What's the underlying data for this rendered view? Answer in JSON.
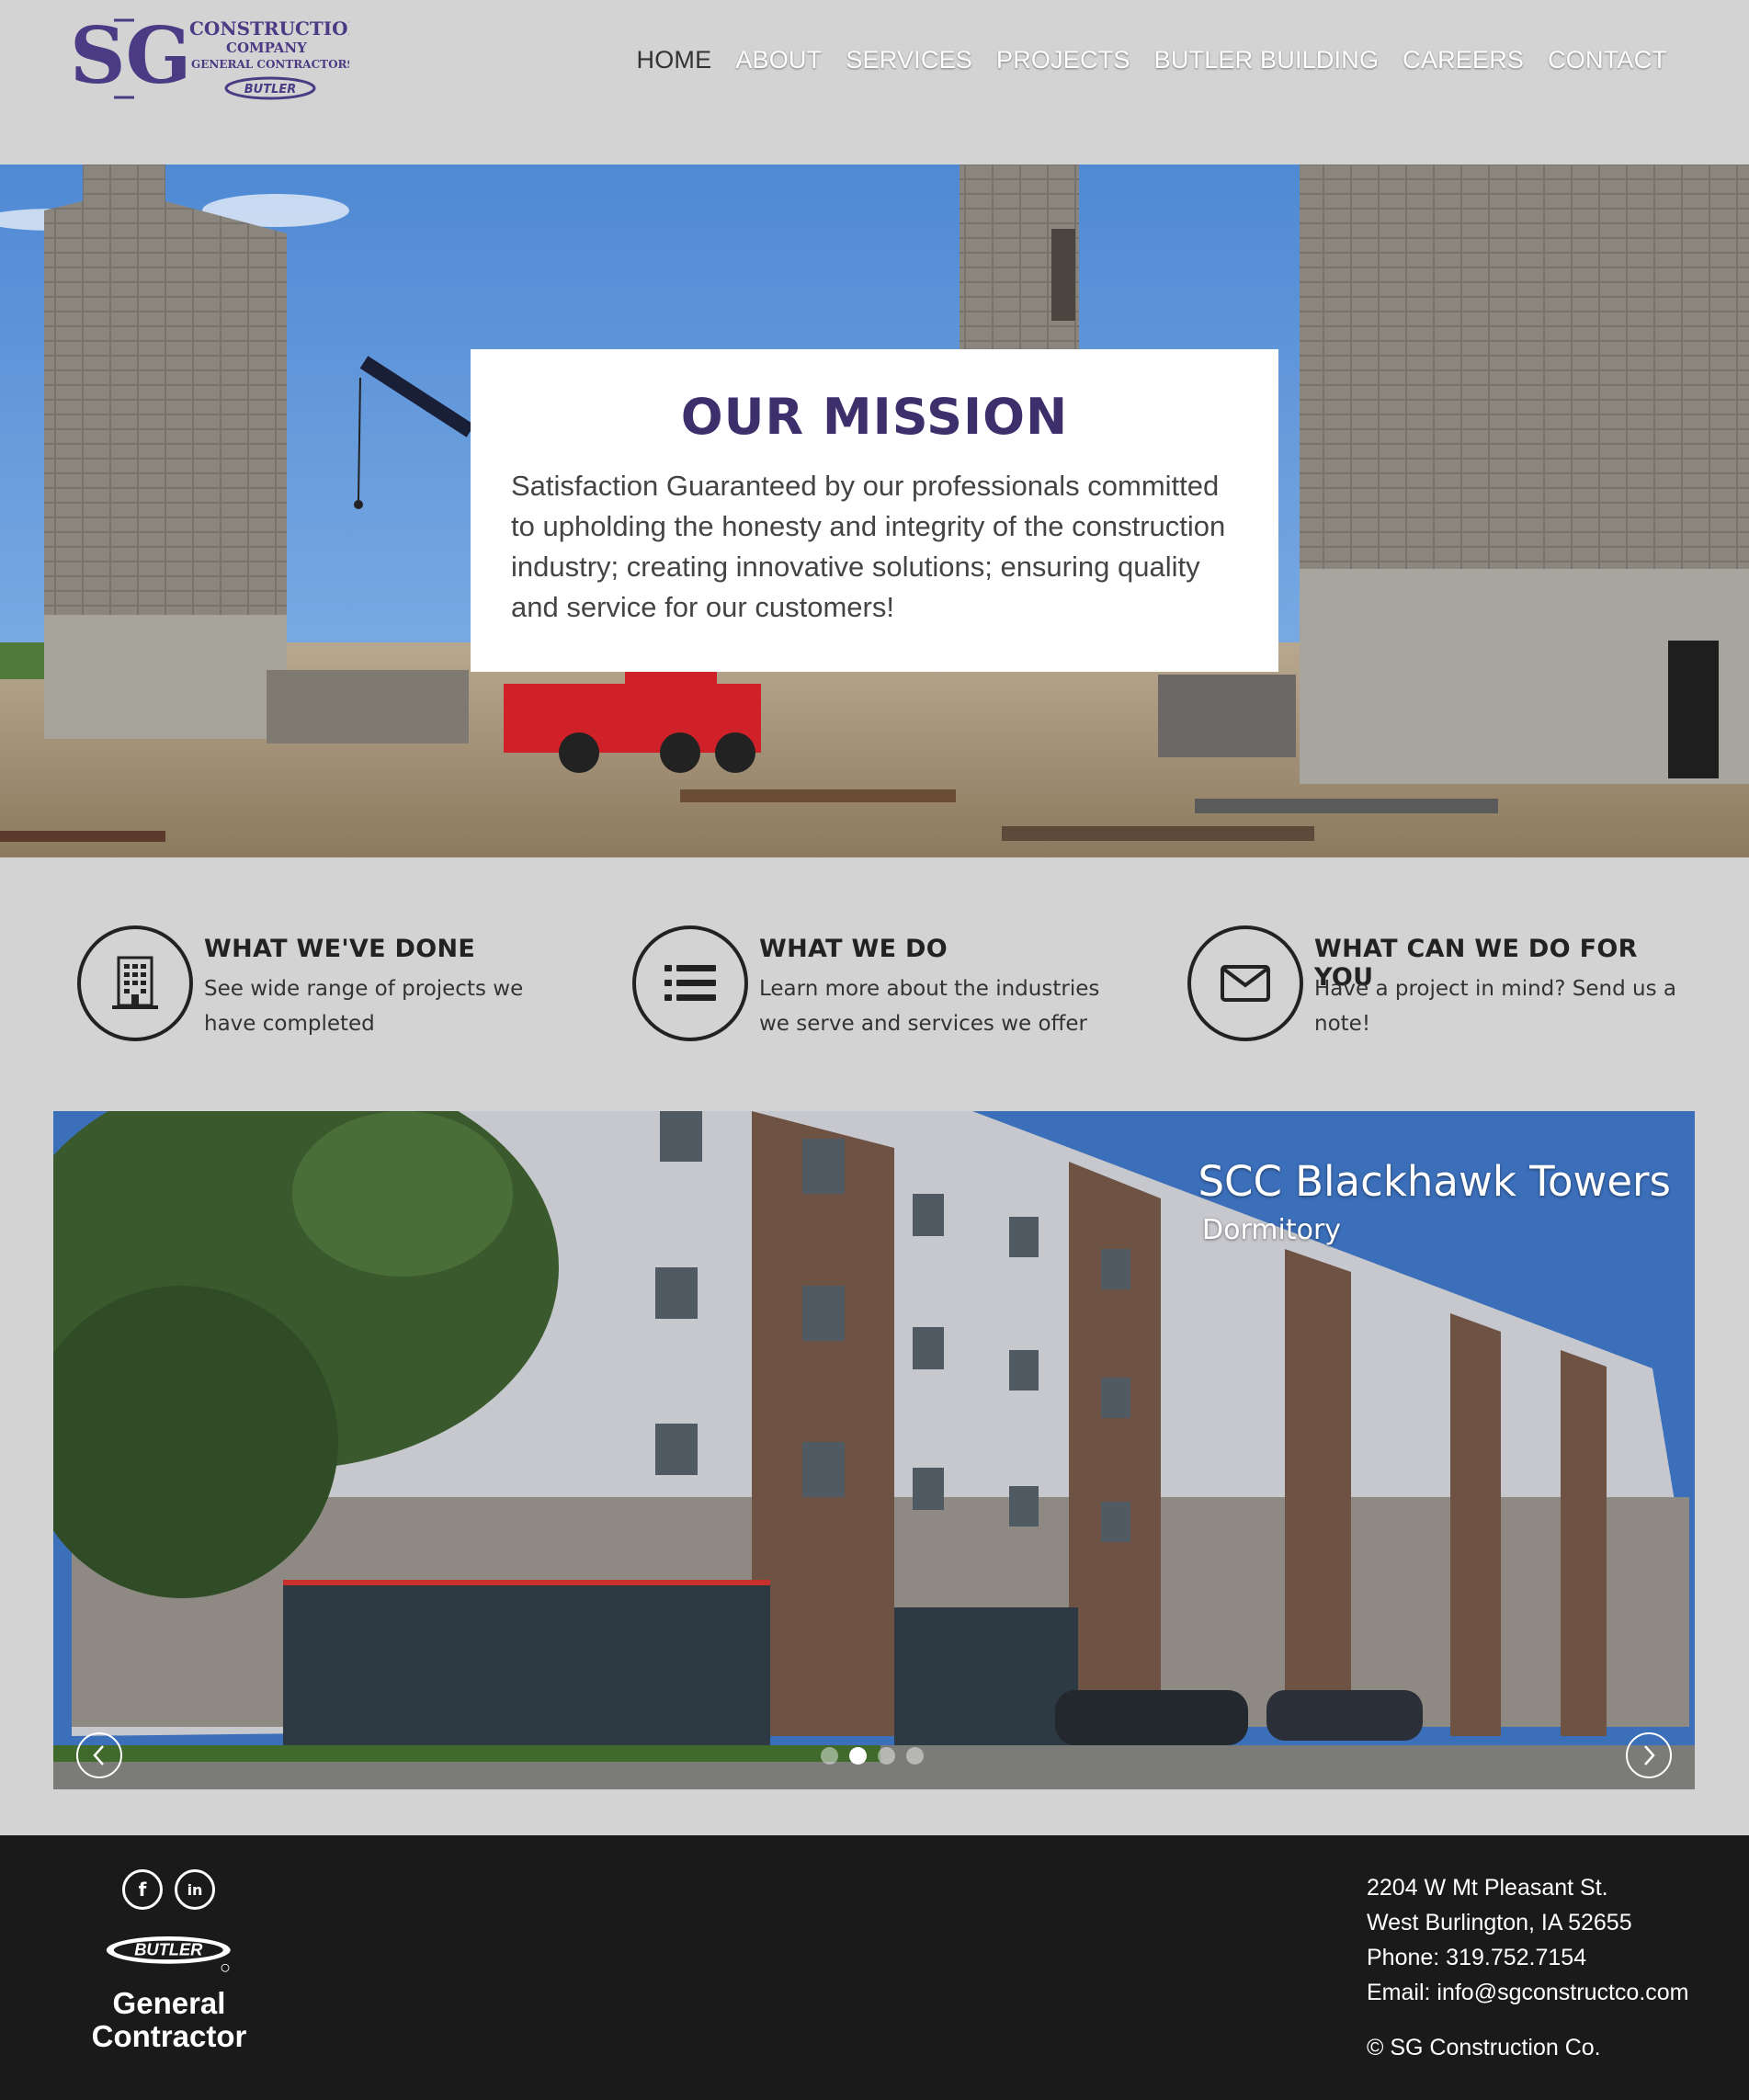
{
  "logo": {
    "monogram": "SG",
    "line1": "CONSTRUCTION",
    "line2": "COMPANY",
    "line3": "GENERAL CONTRACTORS",
    "badge": "BUTLER"
  },
  "nav": {
    "items": [
      "HOME",
      "ABOUT",
      "SERVICES",
      "PROJECTS",
      "BUTLER BUILDING",
      "CAREERS",
      "CONTACT"
    ],
    "active": "HOME"
  },
  "mission": {
    "title": "OUR MISSION",
    "text": "Satisfaction Guaranteed by our professionals committed to upholding the honesty and integrity of the construction industry; creating innovative solutions; ensuring quality and service for our customers!"
  },
  "features": [
    {
      "title": "WHAT WE'VE DONE",
      "desc": "See wide range of projects we have completed",
      "icon": "building-icon"
    },
    {
      "title": "WHAT WE DO",
      "desc": "Learn more about the industries we serve and services we offer",
      "icon": "list-icon"
    },
    {
      "title": "WHAT CAN WE DO FOR YOU",
      "desc": "Have a project in mind? Send us a note!",
      "icon": "envelope-icon"
    }
  ],
  "carousel": {
    "caption_title": "SCC Blackhawk Towers",
    "caption_sub": "Dormitory",
    "slide_count": 4,
    "active_slide": 2
  },
  "footer": {
    "social": [
      "facebook-icon",
      "linkedin-icon"
    ],
    "butler_logo": "BUTLER",
    "butler_line1": "General",
    "butler_line2": "Contractor",
    "address_line1": "2204 W Mt Pleasant St.",
    "address_line2": "West Burlington, IA 52655",
    "phone": "Phone: 319.752.7154",
    "email": "Email: info@sgconstructco.com",
    "copyright": "© SG Construction Co."
  },
  "colors": {
    "brand_purple": "#3d2f6b",
    "header_bg": "#d3d3d3",
    "footer_bg": "#1a1a1a"
  }
}
